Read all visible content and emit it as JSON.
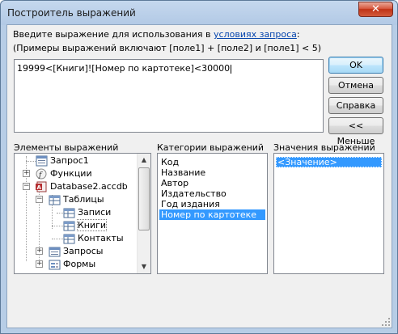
{
  "window": {
    "title": "Построитель выражений",
    "close_label": "✕"
  },
  "prompt": {
    "line1_text": "Введите выражение для использования в ",
    "line1_link": "условиях запроса",
    "line1_end": ":",
    "line2": "(Примеры выражений включают [поле1] + [поле2] и [поле1] < 5)"
  },
  "expression": {
    "value": "19999<[Книги]![Номер по картотеке]<30000"
  },
  "buttons": {
    "ok": "OK",
    "cancel": "Отмена",
    "help": "Справка",
    "less": "<< Меньше"
  },
  "panels": {
    "elements_label": "Элементы выражений",
    "categories_label": "Категории выражений",
    "values_label": "Значения выражений"
  },
  "tree": [
    {
      "label": "Запрос1",
      "icon": "query-icon"
    },
    {
      "label": "Функции",
      "icon": "function-icon"
    },
    {
      "label": "Database2.accdb",
      "icon": "access-db-icon"
    },
    {
      "label": "Таблицы",
      "icon": "tables-folder-icon"
    },
    {
      "label": "Записи",
      "icon": "table-icon"
    },
    {
      "label": "Книги",
      "icon": "table-icon"
    },
    {
      "label": "Контакты",
      "icon": "table-icon"
    },
    {
      "label": "Запросы",
      "icon": "queries-folder-icon"
    },
    {
      "label": "Формы",
      "icon": "forms-folder-icon"
    }
  ],
  "categories": [
    "Код",
    "Название",
    "Автор",
    "Издательство",
    "Год издания",
    "Номер по картотеке"
  ],
  "selected_category": "Номер по картотеке",
  "values": [
    "<Значение>"
  ],
  "colors": {
    "selection": "#3399ff",
    "link": "#0645ad"
  }
}
